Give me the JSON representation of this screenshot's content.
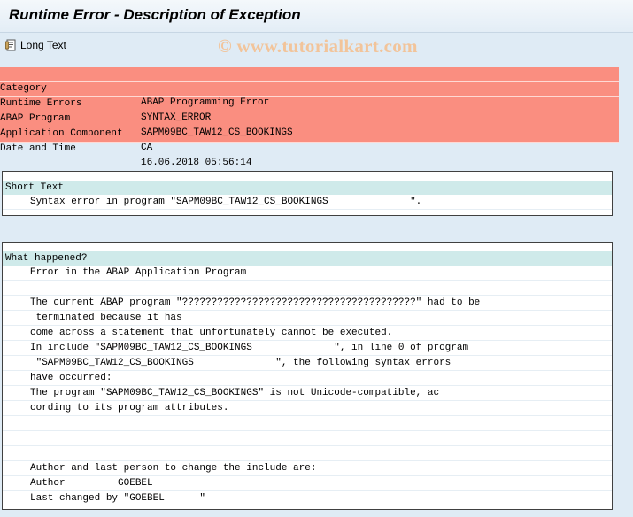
{
  "window": {
    "title": "Runtime Error - Description of Exception"
  },
  "toolbar": {
    "long_text_label": "Long Text"
  },
  "watermark": "© www.tutorialkart.com",
  "error_info": [
    {
      "key": "Category",
      "value": "ABAP Programming Error"
    },
    {
      "key": "Runtime Errors",
      "value": "SYNTAX_ERROR"
    },
    {
      "key": "ABAP Program",
      "value": "SAPM09BC_TAW12_CS_BOOKINGS"
    },
    {
      "key": "Application Component",
      "value": "CA"
    },
    {
      "key": "Date and Time",
      "value": "16.06.2018 05:56:14"
    }
  ],
  "short_text": {
    "header": "Short Text",
    "lines": [
      "Syntax error in program \"SAPM09BC_TAW12_CS_BOOKINGS              \"."
    ]
  },
  "what_happened": {
    "header": "What happened?",
    "lines": [
      "Error in the ABAP Application Program",
      "",
      "The current ABAP program \"????????????????????????????????????????\" had to be",
      " terminated because it has",
      "come across a statement that unfortunately cannot be executed.",
      "In include \"SAPM09BC_TAW12_CS_BOOKINGS              \", in line 0 of program",
      " \"SAPM09BC_TAW12_CS_BOOKINGS              \", the following syntax errors",
      "have occurred:",
      "The program \"SAPM09BC_TAW12_CS_BOOKINGS\" is not Unicode-compatible, ac",
      "cording to its program attributes.",
      "",
      "",
      "",
      "Author and last person to change the include are:",
      "Author         GOEBEL",
      "Last changed by \"GOEBEL      \""
    ]
  },
  "colors": {
    "error_band": "#fa8e80",
    "section_header": "#cfeaea",
    "background": "#dfebf5"
  }
}
